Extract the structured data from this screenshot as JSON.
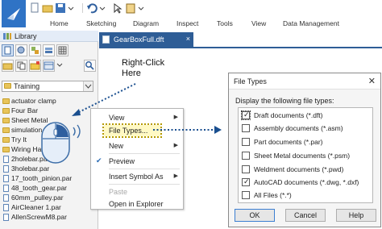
{
  "ribbon": {
    "tabs": [
      "Home",
      "Sketching",
      "Diagram",
      "Inspect",
      "Tools",
      "View",
      "Data Management"
    ]
  },
  "library": {
    "title": "Library",
    "folder": "Training",
    "items": [
      {
        "label": "actuator clamp",
        "kind": "folder"
      },
      {
        "label": "Four Bar",
        "kind": "folder"
      },
      {
        "label": "Sheet Metal",
        "kind": "folder"
      },
      {
        "label": "simulation",
        "kind": "folder"
      },
      {
        "label": "Try It",
        "kind": "folder"
      },
      {
        "label": "Wiring Harn",
        "kind": "folder"
      },
      {
        "label": "2holebar.par",
        "kind": "file"
      },
      {
        "label": "3holebar.par",
        "kind": "file"
      },
      {
        "label": "17_tooth_pinion.par",
        "kind": "file"
      },
      {
        "label": "48_tooth_gear.par",
        "kind": "file"
      },
      {
        "label": "60mm_pulley.par",
        "kind": "file"
      },
      {
        "label": "AirCleaner 1.par",
        "kind": "file"
      },
      {
        "label": "AllenScrewM8.par",
        "kind": "file"
      }
    ]
  },
  "document": {
    "tab_label": "GearBoxFull.dft",
    "close_glyph": "×"
  },
  "annotation": {
    "line1": "Right-Click",
    "line2": "Here"
  },
  "context_menu": {
    "view": "View",
    "file_types": "File Types...",
    "new": "New",
    "preview": "Preview",
    "insert_symbol_as": "Insert Symbol As",
    "paste": "Paste",
    "open_in_explorer": "Open in Explorer",
    "arrow_glyph": "▶",
    "check_glyph": "✔"
  },
  "dialog": {
    "title": "File Types",
    "close_glyph": "✕",
    "prompt": "Display the following file types:",
    "file_types": [
      {
        "label": "Draft documents (*.dft)",
        "checked": true
      },
      {
        "label": "Assembly documents (*.asm)",
        "checked": false
      },
      {
        "label": "Part documents (*.par)",
        "checked": false
      },
      {
        "label": "Sheet Metal documents (*.psm)",
        "checked": false
      },
      {
        "label": "Weldment documents (*.pwd)",
        "checked": false
      },
      {
        "label": "AutoCAD documents (*.dwg, *.dxf)",
        "checked": true
      },
      {
        "label": "All Files (*.*)",
        "checked": false
      }
    ],
    "ok": "OK",
    "cancel": "Cancel",
    "help": "Help"
  },
  "colors": {
    "accent": "#2e5d96",
    "highlight_fill": "#fff9c4",
    "dotted_arrow": "#1a4f8f"
  }
}
